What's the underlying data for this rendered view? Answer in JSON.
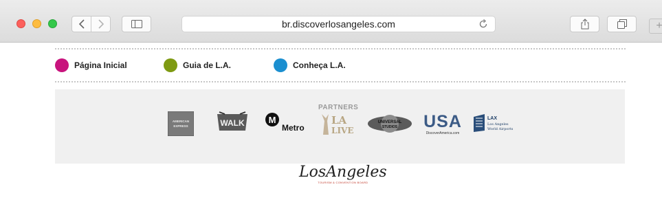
{
  "browser": {
    "url": "br.discoverlosangeles.com",
    "buttons": {
      "back": "back-arrow",
      "forward": "forward-arrow",
      "sidebar": "sidebar",
      "share": "share",
      "tabs": "tab-overview",
      "new_tab": "+"
    }
  },
  "nav": {
    "items": [
      {
        "label": "Página Inicial",
        "color": "#c8137d"
      },
      {
        "label": "Guia de L.A.",
        "color": "#7e9a12"
      },
      {
        "label": "Conheça L.A.",
        "color": "#1b8fd0"
      }
    ]
  },
  "partners": {
    "title": "PARTNERS",
    "logos": [
      {
        "name": "american-express",
        "text": "AMERICAN EXPRESS"
      },
      {
        "name": "citywalk",
        "text": "WALK"
      },
      {
        "name": "metro",
        "text": "Metro"
      },
      {
        "name": "la-live",
        "text": "LA LIVE"
      },
      {
        "name": "universal-studios",
        "text": "UNIVERSAL STUDIOS"
      },
      {
        "name": "usa",
        "text": "USA",
        "subtext": "DiscoverAmerica.com"
      },
      {
        "name": "lax",
        "text": "LAX",
        "subtext": "Los Angeles World Airports"
      }
    ]
  },
  "footer": {
    "logo_script": "LosAngeles",
    "logo_sub": "TOURISM & CONVENTION BOARD"
  }
}
